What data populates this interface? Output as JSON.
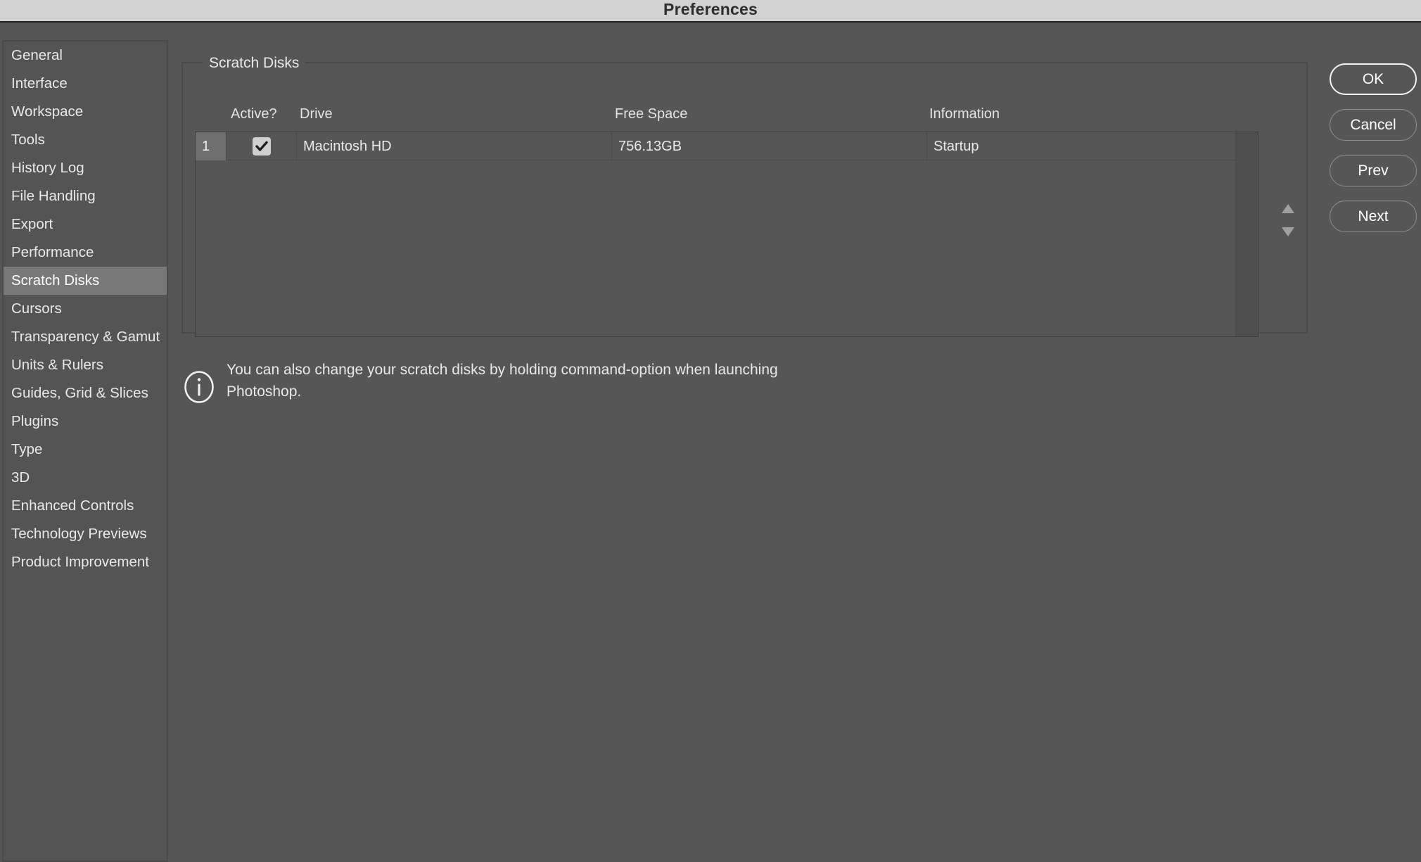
{
  "window": {
    "title": "Preferences"
  },
  "sidebar": {
    "items": [
      {
        "label": "General",
        "selected": false
      },
      {
        "label": "Interface",
        "selected": false
      },
      {
        "label": "Workspace",
        "selected": false
      },
      {
        "label": "Tools",
        "selected": false
      },
      {
        "label": "History Log",
        "selected": false
      },
      {
        "label": "File Handling",
        "selected": false
      },
      {
        "label": "Export",
        "selected": false
      },
      {
        "label": "Performance",
        "selected": false
      },
      {
        "label": "Scratch Disks",
        "selected": true
      },
      {
        "label": "Cursors",
        "selected": false
      },
      {
        "label": "Transparency & Gamut",
        "selected": false
      },
      {
        "label": "Units & Rulers",
        "selected": false
      },
      {
        "label": "Guides, Grid & Slices",
        "selected": false
      },
      {
        "label": "Plugins",
        "selected": false
      },
      {
        "label": "Type",
        "selected": false
      },
      {
        "label": "3D",
        "selected": false
      },
      {
        "label": "Enhanced Controls",
        "selected": false
      },
      {
        "label": "Technology Previews",
        "selected": false
      },
      {
        "label": "Product Improvement",
        "selected": false
      }
    ]
  },
  "panel": {
    "group_legend": "Scratch Disks",
    "table": {
      "columns": [
        "Active?",
        "Drive",
        "Free Space",
        "Information"
      ],
      "rows": [
        {
          "index": "1",
          "active": true,
          "drive": "Macintosh HD",
          "free_space": "756.13GB",
          "information": "Startup"
        }
      ]
    },
    "stepper": {
      "up_icon": "triangle-up-icon",
      "down_icon": "triangle-down-icon"
    },
    "note": {
      "icon": "info-circle-icon",
      "text": "You can also change your scratch disks by holding command-option when launching Photoshop."
    }
  },
  "buttons": [
    {
      "label": "OK",
      "default": true
    },
    {
      "label": "Cancel",
      "default": false
    },
    {
      "label": "Prev",
      "default": false
    },
    {
      "label": "Next",
      "default": false
    }
  ],
  "colors": {
    "dialog_bg": "#565656",
    "titlebar_bg": "#d2d2d2",
    "selection": "#787878",
    "text": "#e8e8e8",
    "index_cell": "#6f6f6f"
  }
}
